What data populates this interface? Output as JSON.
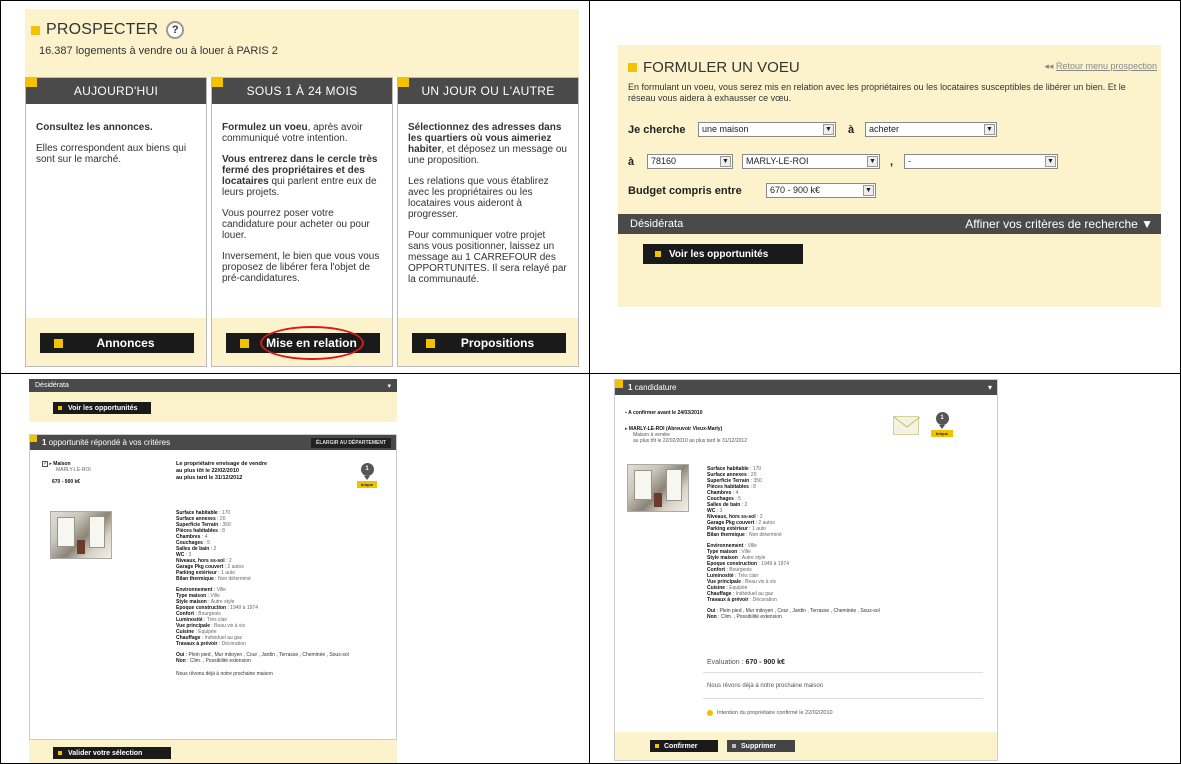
{
  "q1": {
    "title": "PROSPECTER",
    "help_icon": "?",
    "subtitle": "16.387 logements à vendre ou à louer à PARIS 2",
    "columns": [
      {
        "header": "AUJOURD'HUI",
        "paras": [
          [
            "",
            "Consultez les annonces.",
            ""
          ],
          [
            "Elles correspondent aux biens qui sont sur le marché.",
            "",
            ""
          ]
        ],
        "button": "Annonces"
      },
      {
        "header": "SOUS 1 À 24 MOIS",
        "paras": [
          [
            "",
            "Formulez un voeu",
            ", après avoir communiqué votre intention."
          ],
          [
            "",
            "Vous entrerez dans le cercle très fermé des propriétaires et des locataires",
            " qui parlent entre eux de leurs projets."
          ],
          [
            "Vous pourrez poser votre candidature pour acheter ou pour louer.",
            "",
            ""
          ],
          [
            "Inversement, le bien que vous vous proposez de libérer fera l'objet de pré-candidatures.",
            "",
            ""
          ]
        ],
        "button": "Mise en relation"
      },
      {
        "header": "UN JOUR OU L'AUTRE",
        "paras": [
          [
            "",
            "Sélectionnez des adresses dans les quartiers où vous aimeriez habiter",
            ", et déposez un message ou une proposition."
          ],
          [
            "Les relations que vous établirez avec les propriétaires ou les locataires vous aideront à progresser.",
            "",
            ""
          ],
          [
            "Pour communiquer votre projet sans vous positionner, laissez un message au 1 CARREFOUR des OPPORTUNITES. Il sera relayé par la communauté.",
            "",
            ""
          ]
        ],
        "button": "Propositions"
      }
    ]
  },
  "q2": {
    "title": "FORMULER UN VOEU",
    "back_link": "Retour menu prospection",
    "back_arrows": "◂◂",
    "intro": "En formulant un voeu, vous serez mis en relation avec les propriétaires ou les locataires susceptibles de libérer un bien. Et le réseau vous aidera à exhausser ce vœu.",
    "je_cherche_label": "Je cherche",
    "type_value": "une maison",
    "a_label": "à",
    "action_value": "acheter",
    "postal_value": "78160",
    "city_value": "MARLY-LE-ROI",
    "comma": ",",
    "district_value": "-",
    "budget_label": "Budget compris entre",
    "budget_value": "670 - 900 k€",
    "desiderata_label": "Désidérata",
    "refine_label": "Affiner vos critères de recherche ▼",
    "cta": "Voir les opportunités"
  },
  "q3": {
    "bar_label": "Désidérata",
    "bar_arrow": "▾",
    "cta": "Voir les opportunités",
    "panel_title_bold": "1",
    "panel_title_rest": " opportunité répondé à vos critères",
    "chip": "ÉLARGIR AU DÉPARTEMENT",
    "item_type": "Maison",
    "item_city": "MARLY-LE-ROI",
    "item_price": "670 - 900 k€",
    "owner_line1": "Le propriétaire envisage de vendre",
    "owner_line2": "au plus tôt le 22/02/2010",
    "owner_line3": "au plus tard le 31/12/2012",
    "pin_num": "1",
    "pin_tag": "brique",
    "specs1": [
      [
        "Surface habitable",
        "170"
      ],
      [
        "Surface annexes",
        "20"
      ],
      [
        "Superficie Terrain",
        "350"
      ],
      [
        "Pièces habitables",
        "8"
      ],
      [
        "Chambres",
        "4"
      ],
      [
        "Couchages",
        "5"
      ],
      [
        "Salles de bain",
        "2"
      ],
      [
        "WC",
        "3"
      ],
      [
        "Niveaux, hors ss-sol",
        "2"
      ],
      [
        "Garage Pkg couvert",
        "2 autos"
      ],
      [
        "Parking extérieur",
        "1 auto"
      ],
      [
        "Bilan thermique",
        "Non déterminé"
      ]
    ],
    "specs2": [
      [
        "Environnement",
        "Ville"
      ],
      [
        "Type maison",
        "Ville"
      ],
      [
        "Style maison",
        "Autre style"
      ],
      [
        "Epoque construction",
        "1949 à 1974"
      ],
      [
        "Confort",
        "Bourgeois"
      ],
      [
        "Luminosité",
        "Très clair"
      ],
      [
        "Vue principale",
        "Beau vis à vis"
      ],
      [
        "Cuisine",
        "Equipée"
      ],
      [
        "Chauffage",
        "Individuel au gaz"
      ],
      [
        "Travaux à prévoir",
        "Décoration"
      ]
    ],
    "oui_label": "Oui",
    "oui_value": "Plein pied , Mur mitoyen , Cour , Jardin , Terrasse , Cheminée , Sous-sol",
    "non_label": "Non",
    "non_value": "Clim. , Possibilité extension",
    "dream": "Nous rêvons déjà à notre prochaine maison",
    "validate": "Valider votre sélection"
  },
  "q4": {
    "title_bold": "1",
    "title_rest": " candidature",
    "arrow": "▾",
    "confirm_before": "A confirmer avant le 24/03/2010",
    "item_line1": "MARLY-LE-ROI (Abreuvoir Vieux-Marly)",
    "item_line2": "Maison à vendre",
    "item_line3": "au plus tôt le 22/02/2010 au plus tard le 31/12/2012",
    "pin_num": "1",
    "pin_tag": "brique",
    "evaluation_label": "Evaluation :",
    "evaluation_value": "670 - 900 k€",
    "dream": "Nous rêvons déjà à notre prochaine maison",
    "intention": "Intention du propriétaire confirmé le 22/02/2010",
    "confirm": "Confirmer",
    "delete": "Supprimer"
  }
}
